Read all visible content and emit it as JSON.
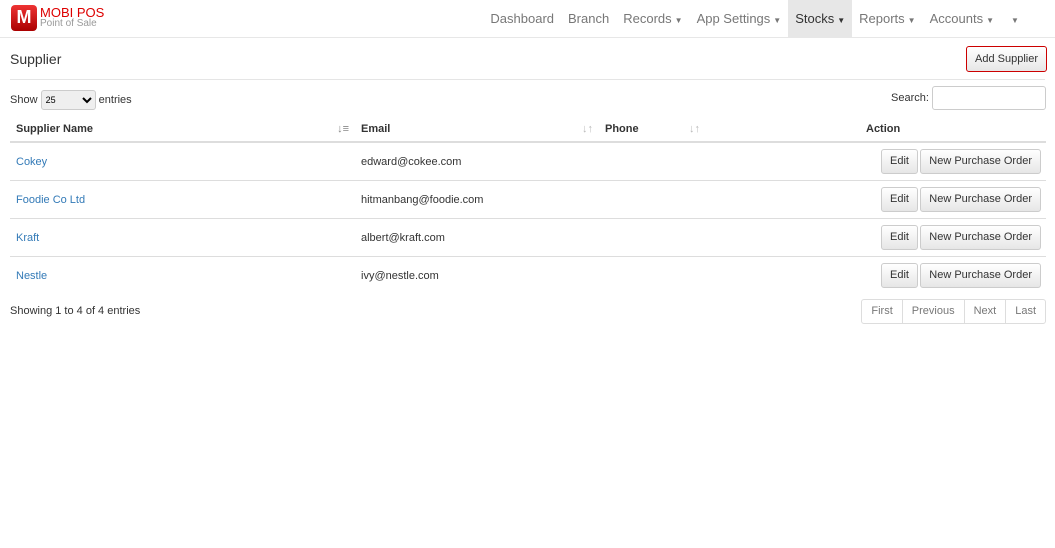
{
  "brand": {
    "name": "MOBI POS",
    "tagline": "Point of Sale",
    "logo_letter": "M"
  },
  "nav": [
    {
      "label": "Dashboard"
    },
    {
      "label": "Branch"
    },
    {
      "label": "Records",
      "caret": true
    },
    {
      "label": "App Settings",
      "caret": true
    },
    {
      "label": "Stocks",
      "caret": true,
      "active": true
    },
    {
      "label": "Reports",
      "caret": true
    },
    {
      "label": "Accounts",
      "caret": true
    }
  ],
  "page": {
    "title": "Supplier",
    "add_label": "Add Supplier"
  },
  "controls": {
    "show": "Show",
    "entries_value": "25",
    "entries": "entries",
    "search": "Search:"
  },
  "table": {
    "headers": [
      "Supplier Name",
      "Email",
      "Phone",
      "Action"
    ],
    "rows": [
      {
        "name": "Cokey",
        "email": "edward@cokee.com",
        "phone": ""
      },
      {
        "name": "Foodie Co Ltd",
        "email": "hitmanbang@foodie.com",
        "phone": ""
      },
      {
        "name": "Kraft",
        "email": "albert@kraft.com",
        "phone": ""
      },
      {
        "name": "Nestle",
        "email": "ivy@nestle.com",
        "phone": ""
      }
    ],
    "edit_label": "Edit",
    "po_label": "New Purchase Order"
  },
  "footer": {
    "info": "Showing 1 to 4 of 4 entries",
    "pages": [
      "First",
      "Previous",
      "Next",
      "Last"
    ]
  }
}
